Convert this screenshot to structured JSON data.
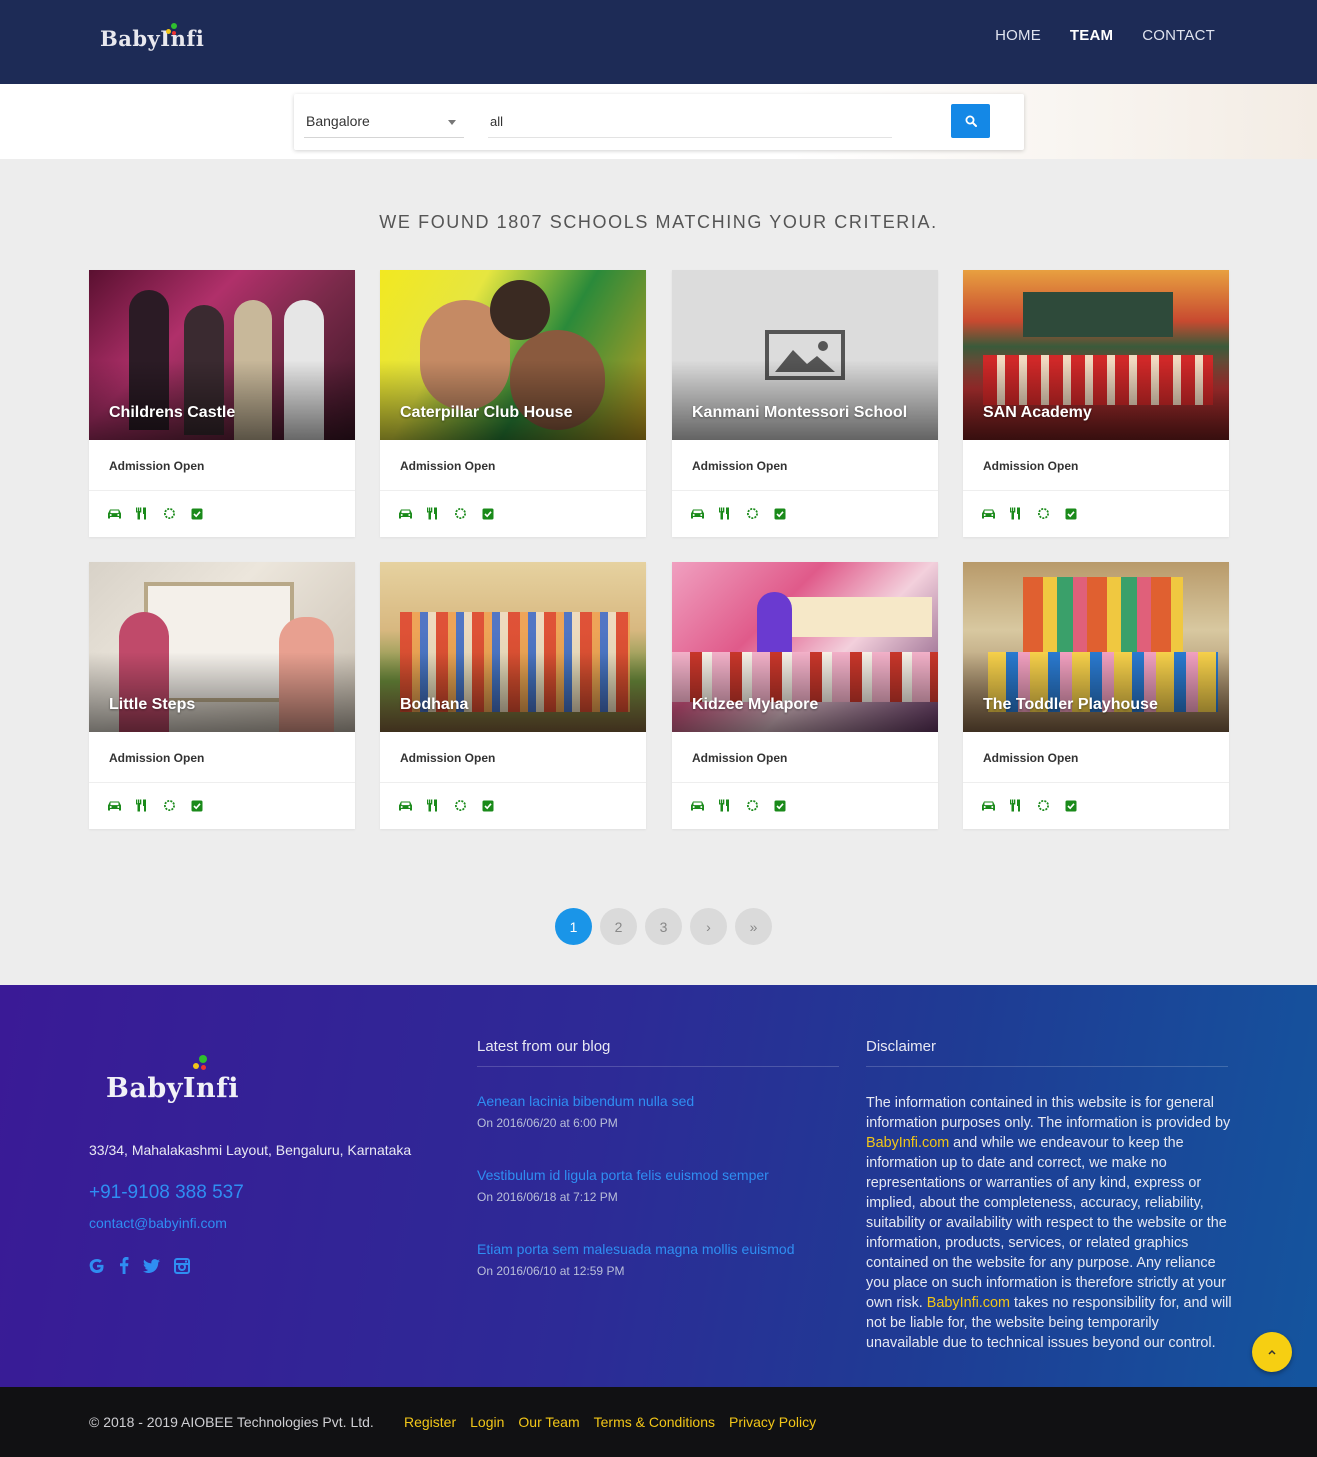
{
  "header": {
    "logo_text": "BabyInfi",
    "nav": [
      {
        "label": "HOME",
        "active": false
      },
      {
        "label": "TEAM",
        "active": true
      },
      {
        "label": "CONTACT",
        "active": false
      }
    ]
  },
  "search": {
    "city": "Bangalore",
    "query": "all",
    "button_icon": "search-icon"
  },
  "results": {
    "heading": "WE FOUND 1807 SCHOOLS MATCHING YOUR CRITERIA.",
    "facility_icons": [
      "car-icon",
      "food-icon",
      "gear-icon",
      "checkbox-icon"
    ],
    "icon_color": "#1a8a1a",
    "schools": [
      {
        "name": "Childrens Castle",
        "status": "Admission Open"
      },
      {
        "name": "Caterpillar Club House",
        "status": "Admission Open"
      },
      {
        "name": "Kanmani Montessori School",
        "status": "Admission Open"
      },
      {
        "name": "SAN Academy",
        "status": "Admission Open"
      },
      {
        "name": "Little Steps",
        "status": "Admission Open"
      },
      {
        "name": "Bodhana",
        "status": "Admission Open"
      },
      {
        "name": "Kidzee Mylapore",
        "status": "Admission Open"
      },
      {
        "name": "The Toddler Playhouse",
        "status": "Admission Open"
      }
    ]
  },
  "pagination": {
    "pages": [
      "1",
      "2",
      "3"
    ],
    "current": "1",
    "next": "›",
    "last": "»"
  },
  "footer": {
    "logo_text": "BabyInfi",
    "address": "33/34, Mahalakashmi Layout, Bengaluru, Karnataka",
    "phone": "+91-9108 388 537",
    "email": "contact@babyinfi.com",
    "socials": [
      "google-icon",
      "facebook-icon",
      "twitter-icon",
      "instagram-icon"
    ],
    "blog_title": "Latest from our blog",
    "blog": [
      {
        "title": "Aenean lacinia bibendum nulla sed",
        "date": "On 2016/06/20 at 6:00 PM"
      },
      {
        "title": "Vestibulum id ligula porta felis euismod semper",
        "date": "On 2016/06/18 at 7:12 PM"
      },
      {
        "title": "Etiam porta sem malesuada magna mollis euismod",
        "date": "On 2016/06/10 at 12:59 PM"
      }
    ],
    "disclaimer_title": "Disclaimer",
    "disclaimer_p1": "The information contained in this website is for general information purposes only. The information is provided by ",
    "disclaimer_link1": "BabyInfi.com",
    "disclaimer_p2": " and while we endeavour to keep the information up to date and correct, we make no representations or warranties of any kind, express or implied, about the completeness, accuracy, reliability, suitability or availability with respect to the website or the information, products, services, or related graphics contained on the website for any purpose. Any reliance you place on such information is therefore strictly at your own risk. ",
    "disclaimer_link2": "BabyInfi.com",
    "disclaimer_p3": " takes no responsibility for, and will not be liable for, the website being temporarily unavailable due to technical issues beyond our control."
  },
  "bottom": {
    "copyright": "© 2018 - 2019 AIOBEE Technologies Pvt. Ltd.",
    "links": [
      "Register",
      "Login",
      "Our Team",
      "Terms & Conditions",
      "Privacy Policy"
    ]
  },
  "colors": {
    "header_bg": "#1d2b56",
    "accent": "#1a95e8",
    "link_yellow": "#f2c618"
  }
}
